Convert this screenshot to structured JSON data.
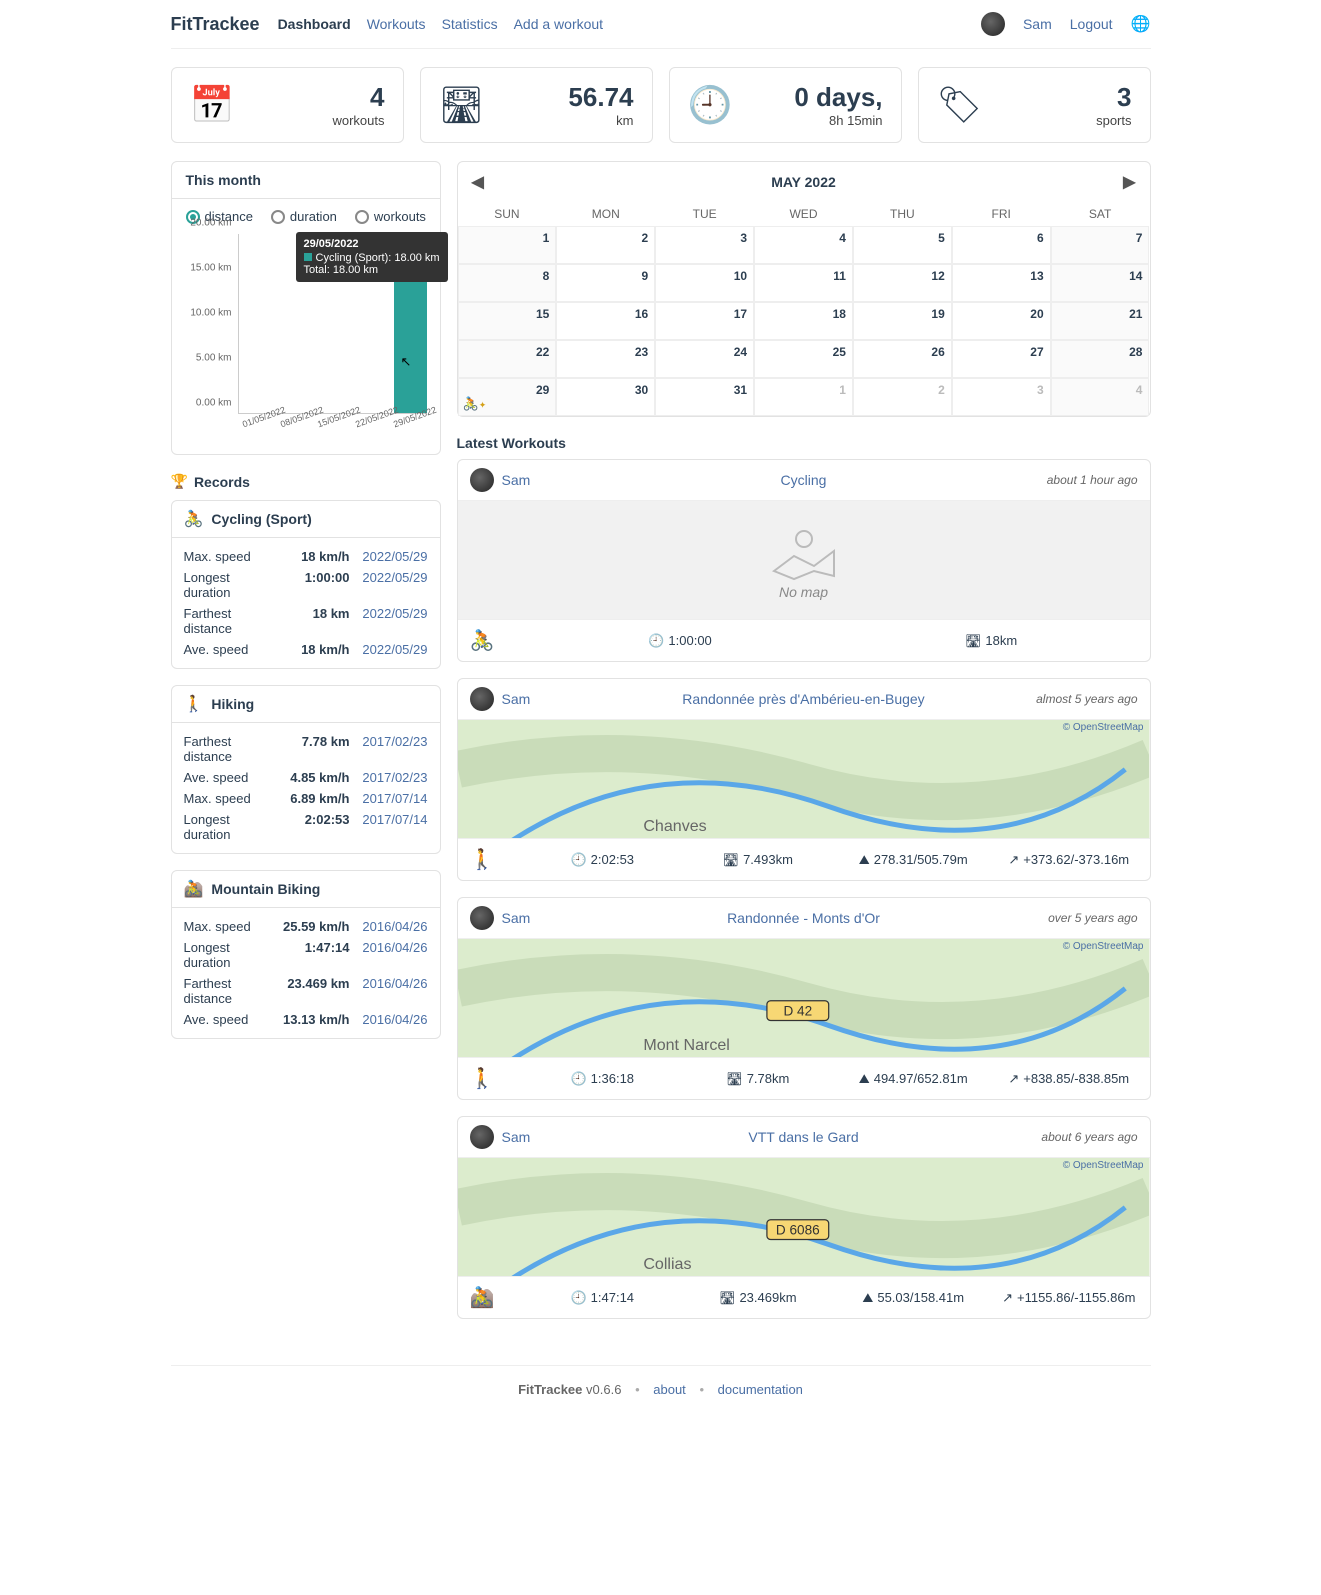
{
  "header": {
    "brand": "FitTrackee",
    "nav": [
      {
        "label": "Dashboard",
        "active": true
      },
      {
        "label": "Workouts"
      },
      {
        "label": "Statistics"
      },
      {
        "label": "Add a workout"
      }
    ],
    "user": "Sam",
    "logout": "Logout"
  },
  "stats": {
    "workouts": {
      "value": "4",
      "label": "workouts"
    },
    "distance": {
      "value": "56.74",
      "label": "km"
    },
    "duration": {
      "value": "0 days,",
      "label": "8h 15min"
    },
    "sports": {
      "value": "3",
      "label": "sports"
    }
  },
  "month_panel": {
    "title": "This month",
    "radios": [
      "distance",
      "duration",
      "workouts"
    ],
    "radio_active": 0,
    "tooltip": {
      "date": "29/05/2022",
      "line": "Cycling (Sport): 18.00 km",
      "total": "Total: 18.00 km"
    }
  },
  "chart_data": {
    "type": "bar",
    "categories": [
      "01/05/2022",
      "08/05/2022",
      "15/05/2022",
      "22/05/2022",
      "29/05/2022"
    ],
    "series": [
      {
        "name": "Cycling (Sport)",
        "values": [
          0,
          0,
          0,
          0,
          18.0
        ]
      }
    ],
    "ylabel": "km",
    "yticks": [
      "0.00 km",
      "5.00 km",
      "10.00 km",
      "15.00 km",
      "20.00 km"
    ],
    "ylim": [
      0,
      20
    ]
  },
  "records": {
    "title": "Records",
    "sports": [
      {
        "name": "Cycling (Sport)",
        "icon": "🚴",
        "cls": "sport-cycling",
        "rows": [
          {
            "label": "Max. speed",
            "value": "18 km/h",
            "date": "2022/05/29"
          },
          {
            "label": "Longest duration",
            "value": "1:00:00",
            "date": "2022/05/29"
          },
          {
            "label": "Farthest distance",
            "value": "18 km",
            "date": "2022/05/29"
          },
          {
            "label": "Ave. speed",
            "value": "18 km/h",
            "date": "2022/05/29"
          }
        ]
      },
      {
        "name": "Hiking",
        "icon": "🚶",
        "cls": "sport-hiking",
        "rows": [
          {
            "label": "Farthest distance",
            "value": "7.78 km",
            "date": "2017/02/23"
          },
          {
            "label": "Ave. speed",
            "value": "4.85 km/h",
            "date": "2017/02/23"
          },
          {
            "label": "Max. speed",
            "value": "6.89 km/h",
            "date": "2017/07/14"
          },
          {
            "label": "Longest duration",
            "value": "2:02:53",
            "date": "2017/07/14"
          }
        ]
      },
      {
        "name": "Mountain Biking",
        "icon": "🚵",
        "cls": "sport-mtb",
        "rows": [
          {
            "label": "Max. speed",
            "value": "25.59 km/h",
            "date": "2016/04/26"
          },
          {
            "label": "Longest duration",
            "value": "1:47:14",
            "date": "2016/04/26"
          },
          {
            "label": "Farthest distance",
            "value": "23.469 km",
            "date": "2016/04/26"
          },
          {
            "label": "Ave. speed",
            "value": "13.13 km/h",
            "date": "2016/04/26"
          }
        ]
      }
    ]
  },
  "calendar": {
    "month_label": "MAY 2022",
    "dow": [
      "SUN",
      "MON",
      "TUE",
      "WED",
      "THU",
      "FRI",
      "SAT"
    ],
    "cells": [
      {
        "n": "1",
        "we": true
      },
      {
        "n": "2"
      },
      {
        "n": "3"
      },
      {
        "n": "4"
      },
      {
        "n": "5"
      },
      {
        "n": "6"
      },
      {
        "n": "7",
        "we": true
      },
      {
        "n": "8",
        "we": true
      },
      {
        "n": "9"
      },
      {
        "n": "10"
      },
      {
        "n": "11"
      },
      {
        "n": "12"
      },
      {
        "n": "13"
      },
      {
        "n": "14",
        "we": true
      },
      {
        "n": "15",
        "we": true
      },
      {
        "n": "16"
      },
      {
        "n": "17"
      },
      {
        "n": "18"
      },
      {
        "n": "19"
      },
      {
        "n": "20"
      },
      {
        "n": "21",
        "we": true
      },
      {
        "n": "22",
        "we": true
      },
      {
        "n": "23"
      },
      {
        "n": "24"
      },
      {
        "n": "25"
      },
      {
        "n": "26"
      },
      {
        "n": "27"
      },
      {
        "n": "28",
        "we": true
      },
      {
        "n": "29",
        "we": true,
        "icon": "🚴",
        "icls": "sport-cycling"
      },
      {
        "n": "30"
      },
      {
        "n": "31"
      },
      {
        "n": "1",
        "other": true
      },
      {
        "n": "2",
        "other": true
      },
      {
        "n": "3",
        "other": true
      },
      {
        "n": "4",
        "other": true,
        "we": true
      }
    ]
  },
  "latest": {
    "title": "Latest Workouts",
    "items": [
      {
        "user": "Sam",
        "title": "Cycling",
        "time": "about 1 hour ago",
        "nomap": true,
        "nomap_text": "No map",
        "sport_icon": "🚴",
        "sport_cls": "sport-cycling",
        "stats": [
          {
            "ico": "🕘",
            "val": "1:00:00"
          },
          {
            "ico": "🛣",
            "val": "18km"
          }
        ]
      },
      {
        "user": "Sam",
        "title": "Randonnée près d'Ambérieu-en-Bugey",
        "time": "almost 5 years ago",
        "osm": "© OpenStreetMap",
        "map_label": "Chanves",
        "sport_icon": "🚶",
        "sport_cls": "sport-hiking",
        "stats": [
          {
            "ico": "🕘",
            "val": "2:02:53"
          },
          {
            "ico": "🛣",
            "val": "7.493km"
          },
          {
            "ico": "⛰",
            "val": "278.31/505.79m"
          },
          {
            "ico": "↗",
            "val": "+373.62/-373.16m"
          }
        ]
      },
      {
        "user": "Sam",
        "title": "Randonnée - Monts d'Or",
        "time": "over 5 years ago",
        "osm": "© OpenStreetMap",
        "map_label": "Mont Narcel",
        "road": "D 42",
        "sport_icon": "🚶",
        "sport_cls": "sport-hiking",
        "stats": [
          {
            "ico": "🕘",
            "val": "1:36:18"
          },
          {
            "ico": "🛣",
            "val": "7.78km"
          },
          {
            "ico": "⛰",
            "val": "494.97/652.81m"
          },
          {
            "ico": "↗",
            "val": "+838.85/-838.85m"
          }
        ]
      },
      {
        "user": "Sam",
        "title": "VTT dans le Gard",
        "time": "about 6 years ago",
        "osm": "© OpenStreetMap",
        "map_label": "Collias",
        "road": "D 6086",
        "sport_icon": "🚵",
        "sport_cls": "sport-mtb",
        "stats": [
          {
            "ico": "🕘",
            "val": "1:47:14"
          },
          {
            "ico": "🛣",
            "val": "23.469km"
          },
          {
            "ico": "⛰",
            "val": "55.03/158.41m"
          },
          {
            "ico": "↗",
            "val": "+1155.86/-1155.86m"
          }
        ]
      }
    ]
  },
  "footer": {
    "app": "FitTrackee",
    "version": "v0.6.6",
    "about": "about",
    "doc": "documentation"
  }
}
